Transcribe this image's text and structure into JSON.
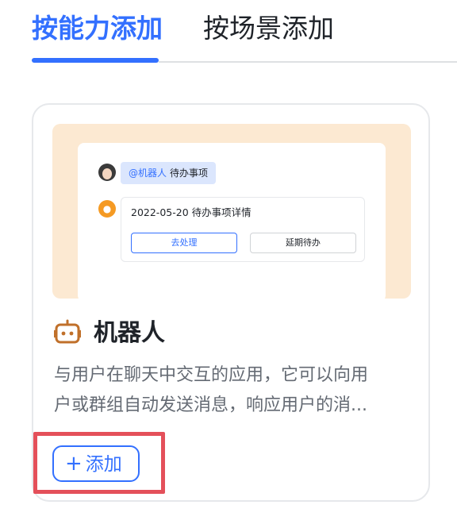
{
  "tabs": [
    {
      "label": "按能力添加",
      "active": true
    },
    {
      "label": "按场景添加",
      "active": false
    }
  ],
  "card": {
    "preview": {
      "mention": "@机器人",
      "message": "待办事项",
      "card_title": "2022-05-20 待办事项详情",
      "primary_button": "去处理",
      "secondary_button": "延期待办"
    },
    "icon": "robot-icon",
    "title": "机器人",
    "description_line1": "与用户在聊天中交互的应用，它可以向用",
    "description_line2": "户或群组自动发送消息，响应用户的消...",
    "add_button": {
      "icon": "+",
      "label": "添加"
    }
  },
  "colors": {
    "accent": "#3370ff",
    "highlight": "#e4505a",
    "preview_bg": "#fce9d2",
    "bot_icon": "#c0702a"
  }
}
